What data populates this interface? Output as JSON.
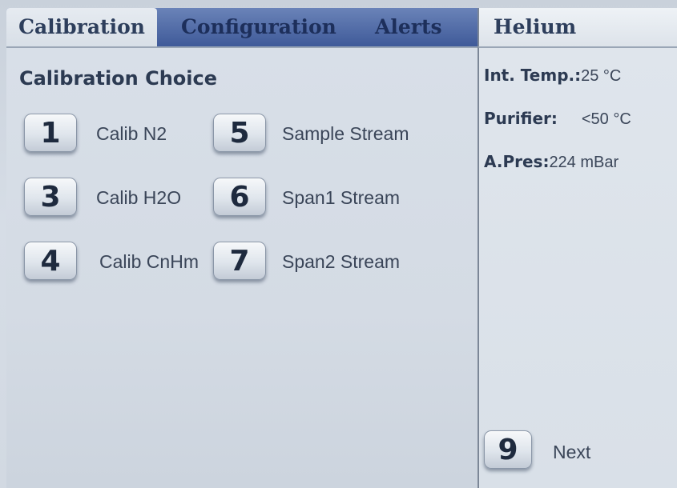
{
  "tabs": [
    {
      "label": "Calibration",
      "active": true
    },
    {
      "label": "Configuration",
      "active": false
    },
    {
      "label": "Alerts",
      "active": false
    }
  ],
  "gas_header": "Helium",
  "main": {
    "title": "Calibration Choice",
    "options": [
      {
        "key": "1",
        "label": "Calib N2"
      },
      {
        "key": "3",
        "label": "Calib H2O"
      },
      {
        "key": "4",
        "label": "Calib CnHm"
      },
      {
        "key": "5",
        "label": "Sample Stream"
      },
      {
        "key": "6",
        "label": "Span1 Stream"
      },
      {
        "key": "7",
        "label": "Span2 Stream"
      }
    ]
  },
  "status": {
    "int_temp": {
      "label": "Int. Temp.:",
      "value": "25 °C"
    },
    "purifier": {
      "label": "Purifier:",
      "value": "<50 °C"
    },
    "a_pres": {
      "label": "A.Pres:",
      "value": "224 mBar"
    }
  },
  "next": {
    "key": "9",
    "label": "Next"
  },
  "colors": {
    "tab_bar": "#3f5a99",
    "tab_text": "#1d2f5b",
    "panel_bg": "#d6dde6"
  }
}
